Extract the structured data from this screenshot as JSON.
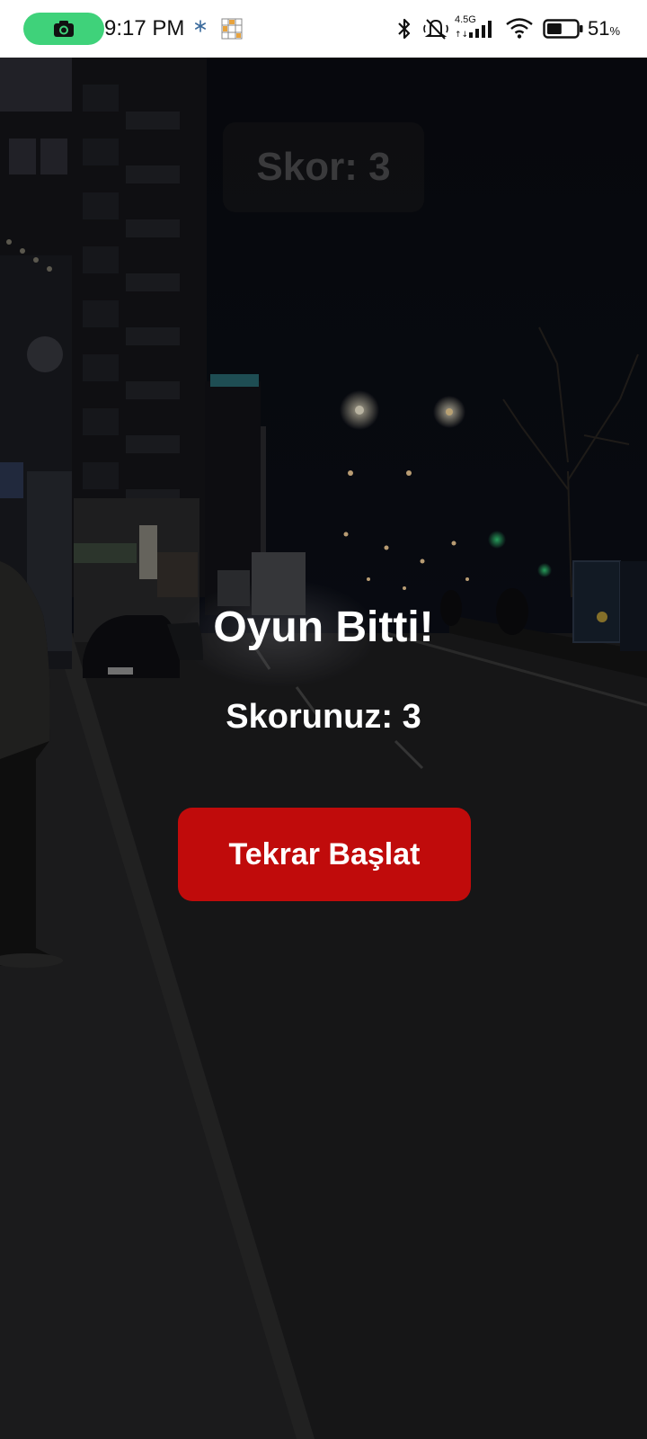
{
  "status_bar": {
    "time": "9:17 PM",
    "network_type": "4.5G",
    "battery_percent": "51",
    "battery_unit": "%",
    "battery_level": 0.51,
    "icons": [
      "camera-icon",
      "snowflake-icon",
      "grid-app-icon",
      "bluetooth-icon",
      "muted-bell-icon",
      "cell-signal-icon",
      "wifi-icon",
      "battery-icon"
    ],
    "accent_color": "#3fd27a"
  },
  "game": {
    "score_chip_label": "Skor: 3",
    "game_over_title": "Oyun Bitti!",
    "final_score_label": "Skorunuz: 3",
    "restart_label": "Tekrar Başlat",
    "restart_color": "#c00b0b"
  }
}
